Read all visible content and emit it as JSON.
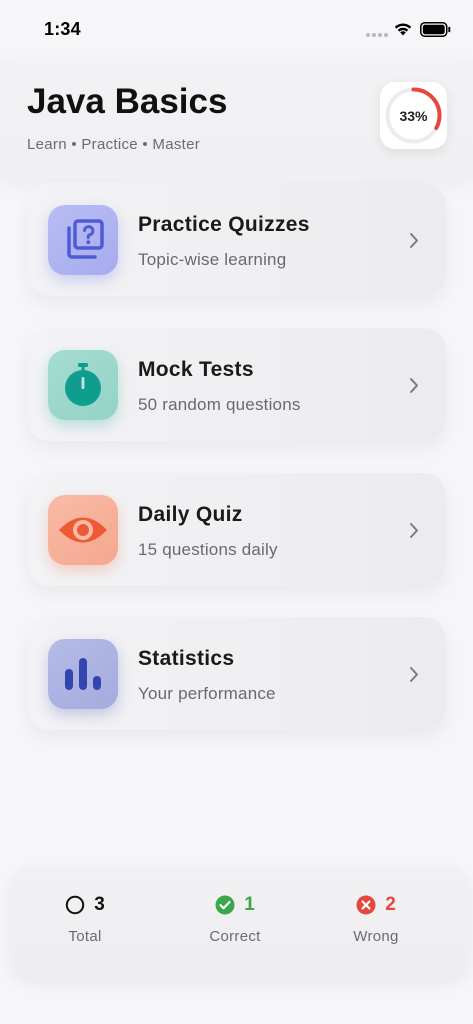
{
  "status": {
    "time": "1:34"
  },
  "header": {
    "title": "Java Basics",
    "subtitle": "Learn • Practice • Master",
    "progress_text": "33%",
    "progress_value": 0.33,
    "progress_color": "#e5483c"
  },
  "cards": [
    {
      "title": "Practice Quizzes",
      "subtitle": "Topic-wise learning",
      "icon": "question-cards-icon",
      "icon_color": "#4f5bd5"
    },
    {
      "title": "Mock Tests",
      "subtitle": "50 random questions",
      "icon": "stopwatch-icon",
      "icon_color": "#0f9e8e"
    },
    {
      "title": "Daily Quiz",
      "subtitle": "15 questions daily",
      "icon": "eye-icon",
      "icon_color": "#ee5a36"
    },
    {
      "title": "Statistics",
      "subtitle": "Your performance",
      "icon": "bar-chart-icon",
      "icon_color": "#3346b0"
    }
  ],
  "stats": [
    {
      "value": "3",
      "label": "Total",
      "icon": "circle-icon",
      "color": "#111111"
    },
    {
      "value": "1",
      "label": "Correct",
      "icon": "check-circle-icon",
      "color": "#3aa84a"
    },
    {
      "value": "2",
      "label": "Wrong",
      "icon": "x-circle-icon",
      "color": "#e5483c"
    }
  ]
}
